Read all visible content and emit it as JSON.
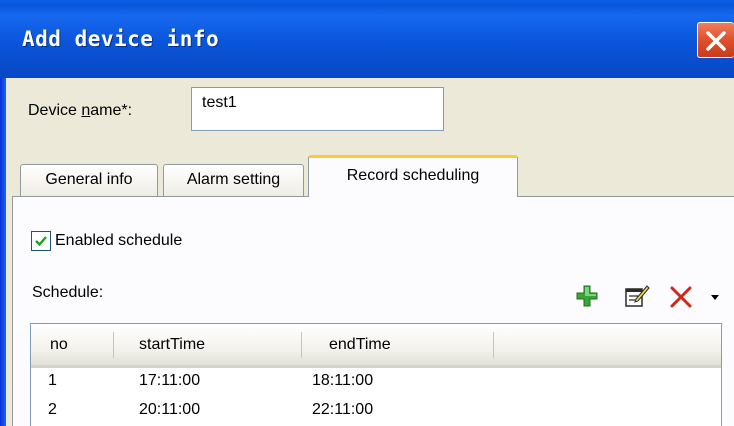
{
  "window": {
    "title": "Add device info"
  },
  "device": {
    "label": "Device name*:",
    "label_underline_letter": "n",
    "value": "test1"
  },
  "tabs": [
    {
      "label": "General info",
      "active": false
    },
    {
      "label": "Alarm setting",
      "active": false
    },
    {
      "label": "Record scheduling",
      "active": true
    }
  ],
  "schedule": {
    "enabled_label": "Enabled schedule",
    "enabled_checked": true,
    "label": "Schedule:",
    "toolbar_icons": [
      "add-icon",
      "edit-icon",
      "delete-icon",
      "dropdown-arrow-icon"
    ],
    "columns": [
      "no",
      "startTime",
      "endTime"
    ],
    "rows": [
      {
        "no": "1",
        "startTime": "17:11:00",
        "endTime": "18:11:00"
      },
      {
        "no": "2",
        "startTime": "20:11:00",
        "endTime": "22:11:00"
      }
    ]
  },
  "colors": {
    "titlebar": "#0a55d9",
    "active_tab_accent": "#ffc83c",
    "close_button": "#e2532f",
    "dialog_bg": "#ece9d8"
  }
}
